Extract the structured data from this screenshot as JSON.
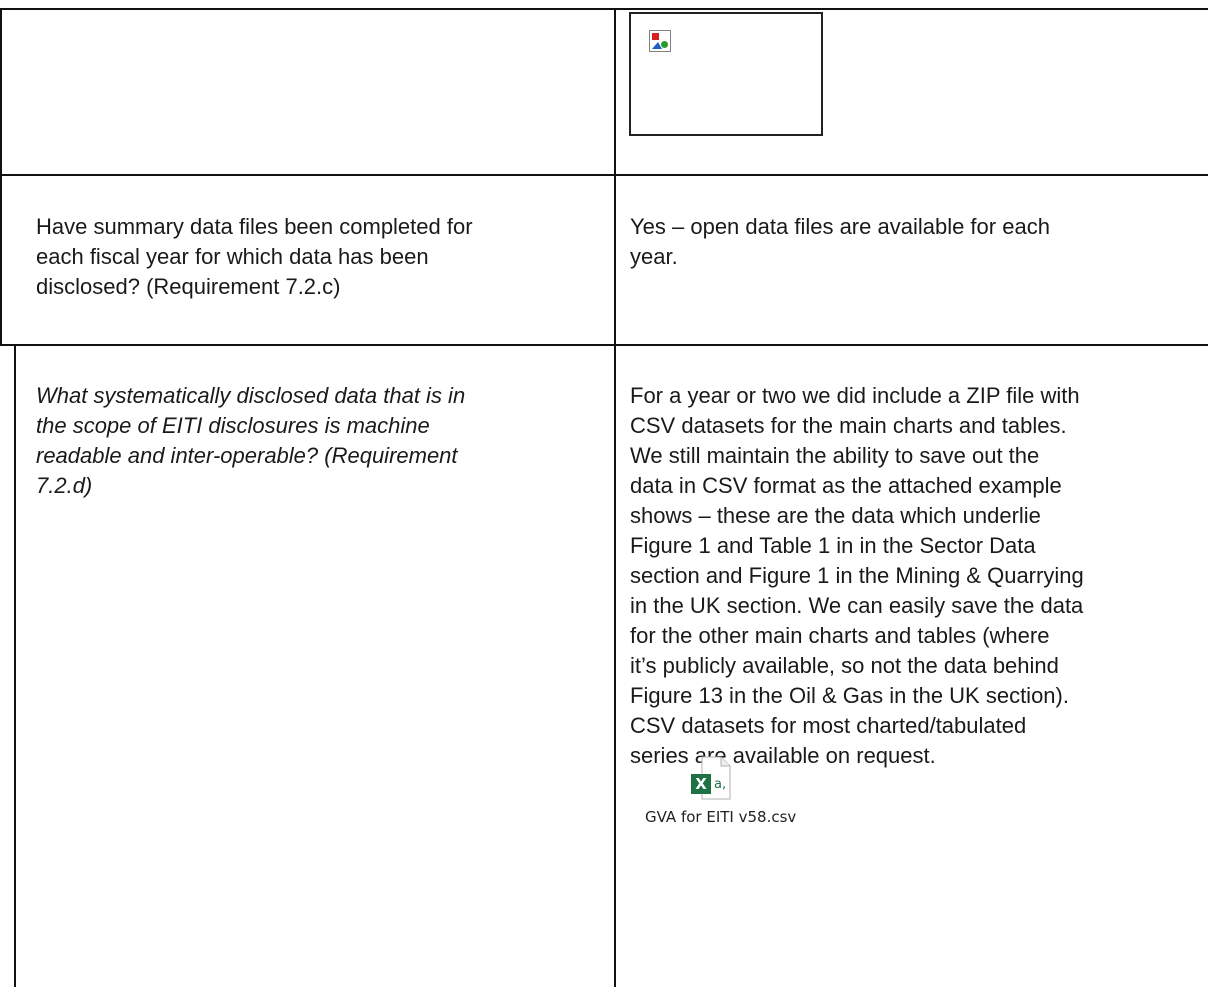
{
  "rows": [
    {
      "question": "",
      "answer": "",
      "image_placeholder": "broken-image-icon"
    },
    {
      "question_lines": [
        "Have summary data files been completed for",
        "each fiscal year for which data has been",
        "disclosed? (Requirement 7.2.c)"
      ],
      "answer_lines": [
        "Yes – open data files are available for each",
        "year."
      ]
    },
    {
      "question_lines": [
        "What systematically disclosed data that is in",
        "the scope of EITI disclosures is machine",
        "readable and inter-operable? (Requirement",
        "7.2.d)"
      ],
      "answer_lines": [
        "For a year or two we did include a ZIP file with",
        "CSV datasets for the main charts and tables.",
        "We still maintain the ability to save out the",
        "data in CSV format as the attached example",
        "shows – these are the data which underlie",
        "Figure 1 and Table 1 in in the Sector Data",
        "section and Figure 1 in the Mining & Quarrying",
        "in the UK section. We can easily save the data",
        "for the other main charts and tables (where",
        "it’s publicly available, so not the data behind",
        "Figure 13 in the Oil & Gas in the UK section).",
        "CSV datasets for most charted/tabulated",
        "series are available on request."
      ],
      "attachment": {
        "file_name": "GVA for EITI v58.csv",
        "icon": "excel-csv-file-icon",
        "icon_color": "#1e7145"
      }
    }
  ]
}
